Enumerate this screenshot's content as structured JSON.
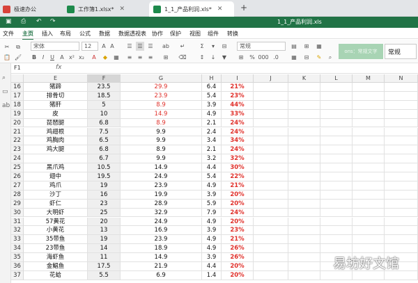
{
  "tabs": {
    "home": "极速办公",
    "workbook1": "工作簿1.xlsx*",
    "active": "1_1_产品利润.xls*",
    "add": "+"
  },
  "doc_title": "1_1_产品利润.xls",
  "menu": [
    "文件",
    "主页",
    "插入",
    "布局",
    "公式",
    "数据",
    "数据透视表",
    "协作",
    "保护",
    "视图",
    "组件",
    "转换"
  ],
  "menu_active": "主页",
  "ribbon": {
    "font_name": "宋体",
    "font_size": "12",
    "number_format": "常规",
    "cell_style": "常规",
    "style_preview": "ons：常规文字"
  },
  "name_box": "F1",
  "fx_label": "fx",
  "columns": [
    "E",
    "F",
    "G",
    "H",
    "I",
    "J",
    "K",
    "L",
    "M",
    "N"
  ],
  "rows": [
    {
      "n": "16",
      "e": "猪蹄",
      "f": "23.5",
      "g": "29.9",
      "h": "6.4",
      "i": "21%",
      "gRed": true
    },
    {
      "n": "17",
      "e": "排骨切",
      "f": "18.5",
      "g": "23.9",
      "h": "5.4",
      "i": "23%",
      "gRed": true
    },
    {
      "n": "18",
      "e": "猪肝",
      "f": "5",
      "g": "8.9",
      "h": "3.9",
      "i": "44%",
      "gRed": true
    },
    {
      "n": "19",
      "e": "皮",
      "f": "10",
      "g": "14.9",
      "h": "4.9",
      "i": "33%",
      "gRed": true
    },
    {
      "n": "20",
      "e": "琵琶腿",
      "f": "6.8",
      "g": "8.9",
      "h": "2.1",
      "i": "24%",
      "gRed": true
    },
    {
      "n": "21",
      "e": "鸡翅根",
      "f": "7.5",
      "g": "9.9",
      "h": "2.4",
      "i": "24%",
      "gRed": false
    },
    {
      "n": "22",
      "e": "鸡胸肉",
      "f": "6.5",
      "g": "9.9",
      "h": "3.4",
      "i": "34%",
      "gRed": false
    },
    {
      "n": "23",
      "e": "鸡大腿",
      "f": "6.8",
      "g": "8.9",
      "h": "2.1",
      "i": "24%",
      "gRed": false
    },
    {
      "n": "24",
      "e": "",
      "f": "6.7",
      "g": "9.9",
      "h": "3.2",
      "i": "32%",
      "gRed": false
    },
    {
      "n": "25",
      "e": "黑爪鸡",
      "f": "10.5",
      "g": "14.9",
      "h": "4.4",
      "i": "30%",
      "gRed": false
    },
    {
      "n": "26",
      "e": "翅中",
      "f": "19.5",
      "g": "24.9",
      "h": "5.4",
      "i": "22%",
      "gRed": false
    },
    {
      "n": "27",
      "e": "鸡爪",
      "f": "19",
      "g": "23.9",
      "h": "4.9",
      "i": "21%",
      "gRed": false
    },
    {
      "n": "28",
      "e": "沙丁",
      "f": "16",
      "g": "19.9",
      "h": "3.9",
      "i": "20%",
      "gRed": false
    },
    {
      "n": "29",
      "e": "虾仁",
      "f": "23",
      "g": "28.9",
      "h": "5.9",
      "i": "20%",
      "gRed": false
    },
    {
      "n": "30",
      "e": "大明虾",
      "f": "25",
      "g": "32.9",
      "h": "7.9",
      "i": "24%",
      "gRed": false
    },
    {
      "n": "31",
      "e": "57黄花",
      "f": "20",
      "g": "24.9",
      "h": "4.9",
      "i": "20%",
      "gRed": false
    },
    {
      "n": "32",
      "e": "小黄花",
      "f": "13",
      "g": "16.9",
      "h": "3.9",
      "i": "23%",
      "gRed": false
    },
    {
      "n": "33",
      "e": "35带鱼",
      "f": "19",
      "g": "23.9",
      "h": "4.9",
      "i": "21%",
      "gRed": false
    },
    {
      "n": "34",
      "e": "23带鱼",
      "f": "14",
      "g": "18.9",
      "h": "4.9",
      "i": "26%",
      "gRed": false
    },
    {
      "n": "35",
      "e": "海虾鱼",
      "f": "11",
      "g": "14.9",
      "h": "3.9",
      "i": "26%",
      "gRed": false
    },
    {
      "n": "36",
      "e": "金鲳鱼",
      "f": "17.5",
      "g": "21.9",
      "h": "4.4",
      "i": "20%",
      "gRed": false
    },
    {
      "n": "37",
      "e": "花蛤",
      "f": "5.5",
      "g": "6.9",
      "h": "1.4",
      "i": "20%",
      "gRed": false
    }
  ],
  "watermark": "易坊好文馆",
  "colors": {
    "accent": "#217346",
    "red": "#e0302a"
  }
}
